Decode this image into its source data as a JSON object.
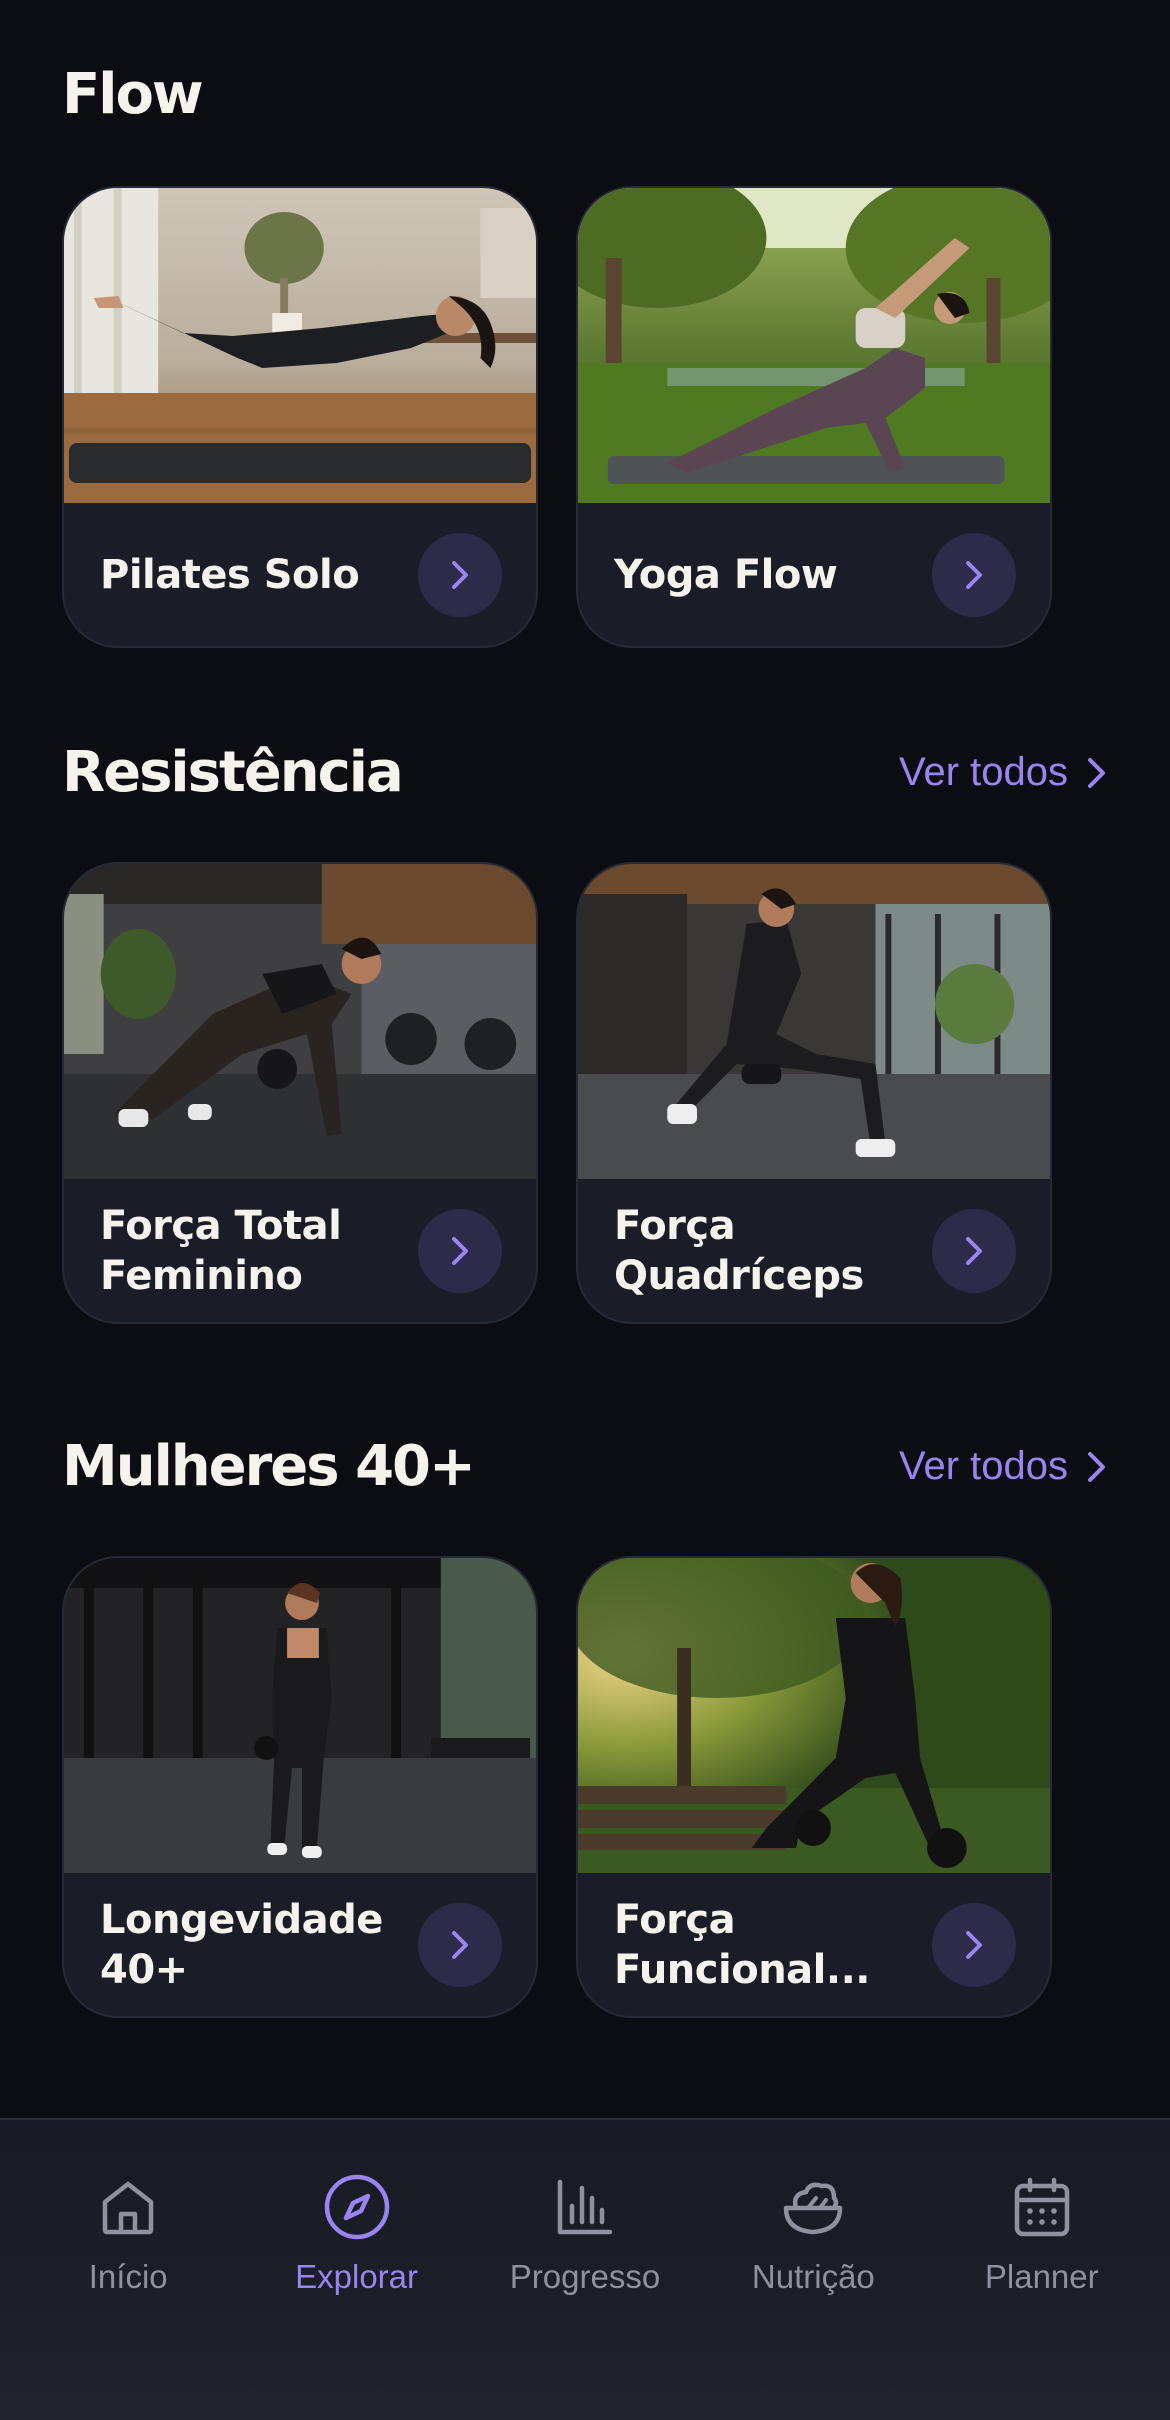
{
  "sections": [
    {
      "title": "Flow",
      "see_all": "",
      "cards": [
        {
          "title": "Pilates Solo",
          "image": "woman-pilates-mat-living-room-photo"
        },
        {
          "title": "Yoga Flow",
          "image": "woman-yoga-side-angle-park-photo"
        }
      ]
    },
    {
      "title": "Resistência",
      "see_all": "Ver todos",
      "cards": [
        {
          "title": "Força Total\nFeminino",
          "image": "woman-kettlebell-plank-gym-photo"
        },
        {
          "title": "Força\nQuadríceps",
          "image": "woman-dumbbell-lunge-gym-photo"
        }
      ]
    },
    {
      "title": "Mulheres 40+",
      "see_all": "Ver todos",
      "cards": [
        {
          "title": "Longevidade\n40+",
          "image": "woman-walking-kettlebell-gym-photo"
        },
        {
          "title": "Força\nFuncional...",
          "image": "woman-kettlebell-park-bench-photo"
        }
      ]
    }
  ],
  "icons": {
    "see_all": "chevron-right-icon",
    "card_action": "chevron-right-icon"
  },
  "nav": {
    "active_index": 1,
    "items": [
      {
        "label": "Início",
        "icon": "home-icon"
      },
      {
        "label": "Explorar",
        "icon": "compass-icon"
      },
      {
        "label": "Progresso",
        "icon": "bar-chart-icon"
      },
      {
        "label": "Nutrição",
        "icon": "salad-bowl-icon"
      },
      {
        "label": "Planner",
        "icon": "calendar-icon"
      }
    ]
  },
  "colors": {
    "background": "#0c0d12",
    "card": "#1a1d27",
    "accent": "#9a84f0",
    "arrow_bg": "#2e2b4a",
    "nav_inactive": "#8e919e"
  }
}
